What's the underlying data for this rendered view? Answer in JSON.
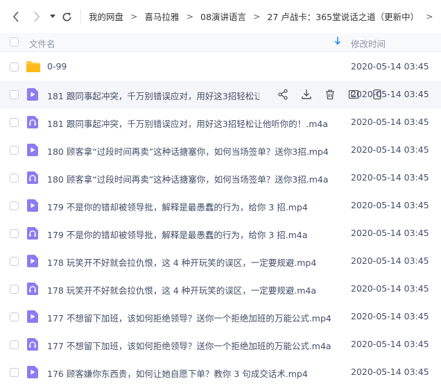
{
  "nav": {
    "back_icon": "chevron-left-icon",
    "forward_icon": "chevron-right-icon",
    "dropdown_icon": "caret-down-icon",
    "refresh_icon": "refresh-icon",
    "breadcrumbs": [
      "我的网盘",
      "喜马拉雅",
      "08演讲语言",
      "27 卢战卡：365堂说话之道（更新中）"
    ],
    "breadcrumb_separator": ">",
    "trailing_separator": ">"
  },
  "header": {
    "name_label": "文件名",
    "time_label": "修改时间",
    "sort_icon": "sort-down-icon"
  },
  "colors": {
    "folder": "#ffc940",
    "video": "#8c7cf0",
    "audio": "#8c7cf0",
    "sort": "#2d8cf0",
    "hover_row": "#f4f6fa"
  },
  "files": [
    {
      "type": "folder",
      "name": "0-99",
      "time": "2020-05-14 03:45"
    },
    {
      "type": "video",
      "name": "181 跟同事起冲突，千万别错误应对，用好这3招轻松让...",
      "time": "2020-05-14 03:45",
      "hover": true
    },
    {
      "type": "audio",
      "name": "181 跟同事起冲突，千万别错误应对，用好这3招轻松让他听你的！.m4a",
      "time": "2020-05-14 03:45"
    },
    {
      "type": "video",
      "name": "180 顾客拿“过段时间再卖”这种话搪塞你，如何当场签单？送你3招.mp4",
      "time": "2020-05-14 03:45"
    },
    {
      "type": "audio",
      "name": "180 顾客拿“过段时间再卖”这种话搪塞你，如何当场签单？送你3招.m4a",
      "time": "2020-05-14 03:45"
    },
    {
      "type": "video",
      "name": "179 不是你的错却被领导批，解释是最愚蠢的行为，给你 3 招.mp4",
      "time": "2020-05-14 03:45"
    },
    {
      "type": "audio",
      "name": "179 不是你的错却被领导批，解释是最愚蠢的行为，给你 3 招.m4a",
      "time": "2020-05-14 03:45"
    },
    {
      "type": "video",
      "name": "178 玩笑开不好就会拉仇恨，这 4 种开玩笑的误区，一定要规避.mp4",
      "time": "2020-05-14 03:45"
    },
    {
      "type": "audio",
      "name": "178 玩笑开不好就会拉仇恨，这 4 种开玩笑的误区，一定要规避.m4a",
      "time": "2020-05-14 03:45"
    },
    {
      "type": "video",
      "name": "177 不想留下加班，该如何拒绝领导？送你一个拒绝加班的万能公式.mp4",
      "time": "2020-05-14 03:45"
    },
    {
      "type": "audio",
      "name": "177 不想留下加班，该如何拒绝领导？送你一个拒绝加班的万能公式.m4a",
      "time": "2020-05-14 03:45"
    },
    {
      "type": "video",
      "name": "176 顾客嫌你东西贵，如何让她自愿下单？教你 3 句成交话术.mp4",
      "time": "2020-05-14 03:45"
    }
  ],
  "row_actions": [
    "share-icon",
    "download-icon",
    "delete-icon",
    "rename-icon",
    "more-icon"
  ]
}
